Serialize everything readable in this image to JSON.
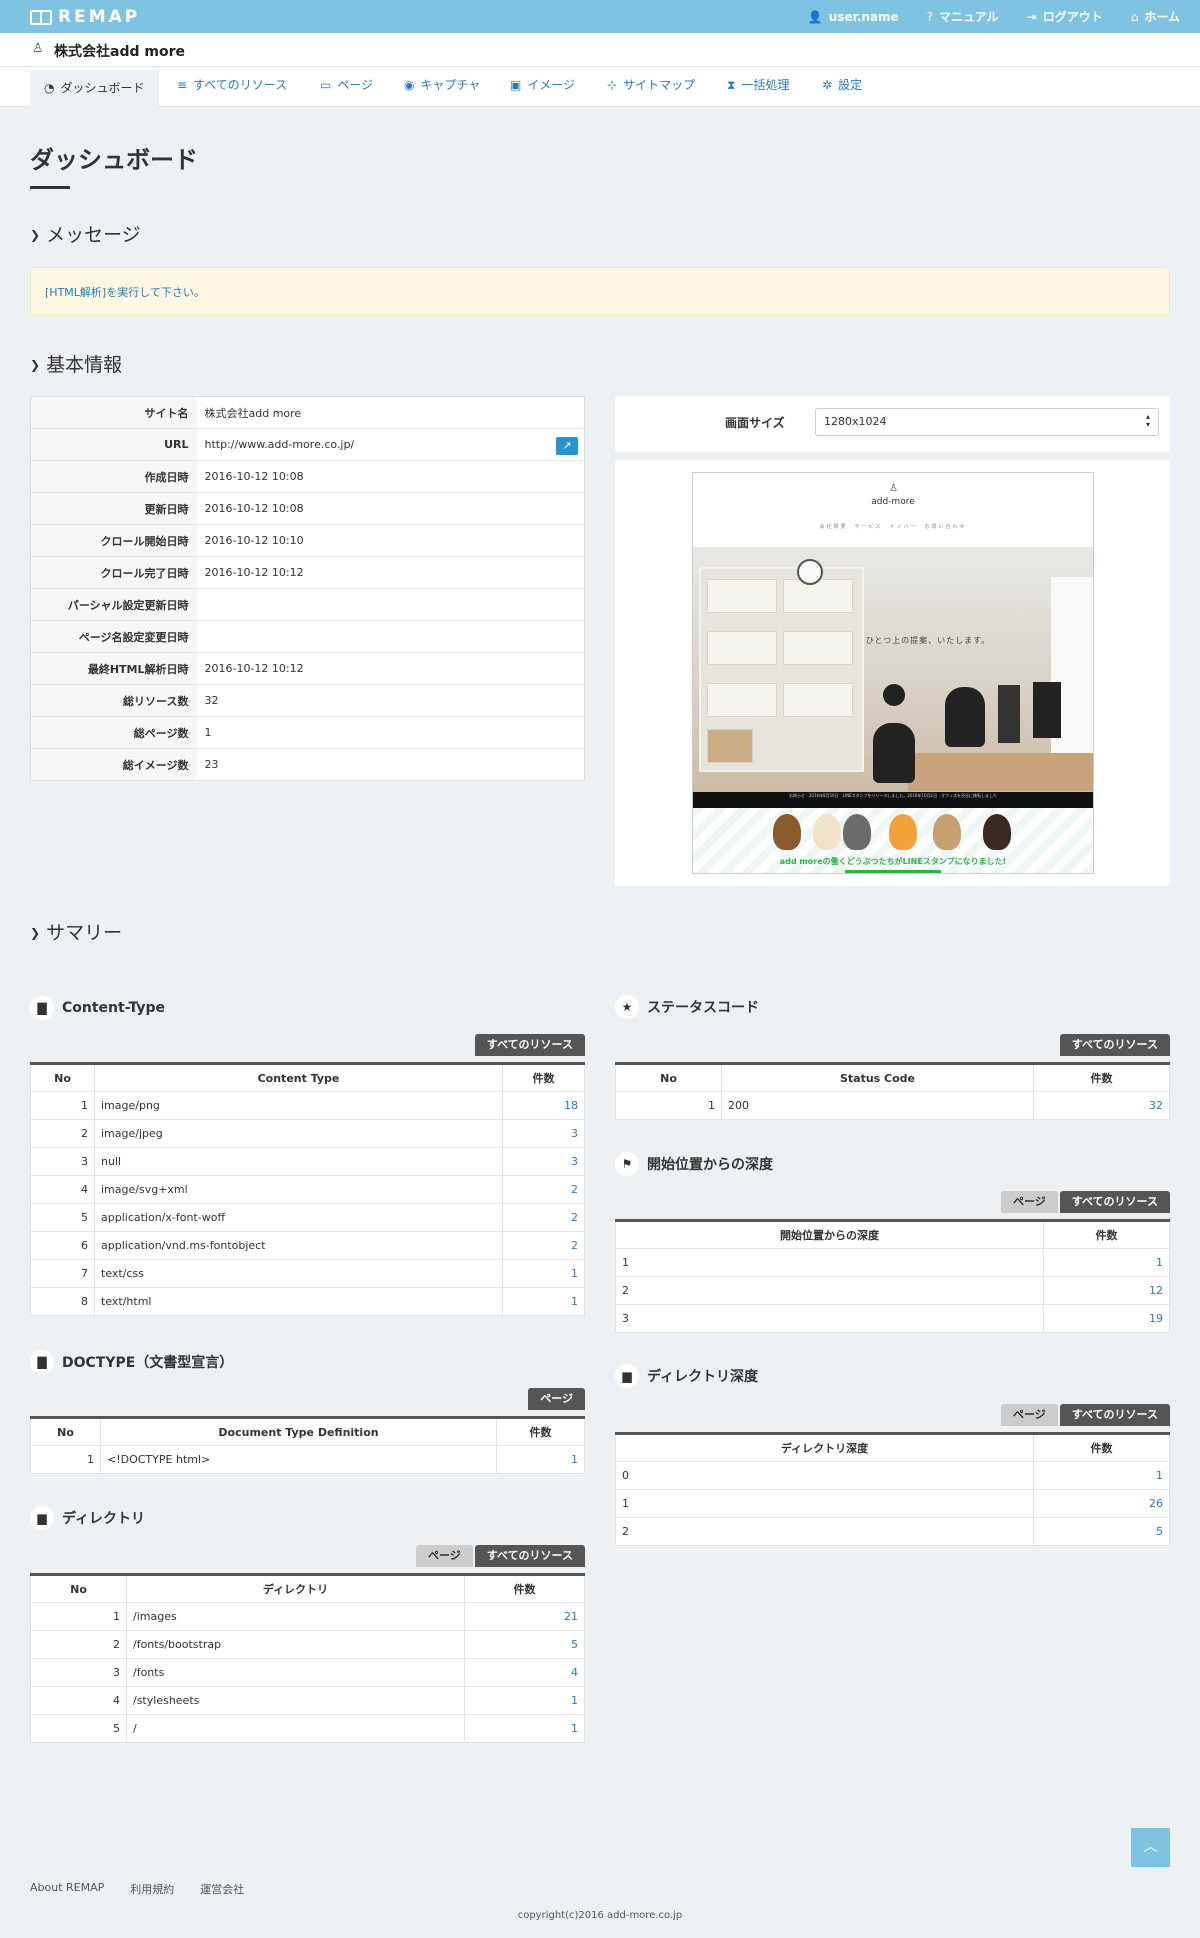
{
  "app": {
    "logo": "REMAP"
  },
  "topnav": [
    {
      "icon": "user-icon",
      "glyph": "👤",
      "label": "user.name"
    },
    {
      "icon": "help-icon",
      "glyph": "?",
      "label": "マニュアル"
    },
    {
      "icon": "logout-icon",
      "glyph": "⇥",
      "label": "ログアウト"
    },
    {
      "icon": "home-icon",
      "glyph": "⌂",
      "label": "ホーム"
    }
  ],
  "site": {
    "name": "株式会社add more"
  },
  "tabs": [
    {
      "label": "ダッシュボード",
      "glyph": "◔"
    },
    {
      "label": "すべてのリソース",
      "glyph": "≡"
    },
    {
      "label": "ページ",
      "glyph": "▭"
    },
    {
      "label": "キャプチャ",
      "glyph": "◉"
    },
    {
      "label": "イメージ",
      "glyph": "▣"
    },
    {
      "label": "サイトマップ",
      "glyph": "⊹"
    },
    {
      "label": "一括処理",
      "glyph": "⧗"
    },
    {
      "label": "設定",
      "glyph": "✲"
    }
  ],
  "page": {
    "title": "ダッシュボード"
  },
  "sections": {
    "message": "メッセージ",
    "basic": "基本情報",
    "summary": "サマリー"
  },
  "message": {
    "text": "[HTML解析]を実行して下さい。"
  },
  "info": {
    "rows": [
      {
        "k": "サイト名",
        "v": "株式会社add more"
      },
      {
        "k": "URL",
        "v": "http://www.add-more.co.jp/"
      },
      {
        "k": "作成日時",
        "v": "2016-10-12 10:08"
      },
      {
        "k": "更新日時",
        "v": "2016-10-12 10:08"
      },
      {
        "k": "クロール開始日時",
        "v": "2016-10-12 10:10"
      },
      {
        "k": "クロール完了日時",
        "v": "2016-10-12 10:12"
      },
      {
        "k": "パーシャル設定更新日時",
        "v": ""
      },
      {
        "k": "ページ名設定変更日時",
        "v": ""
      },
      {
        "k": "最終HTML解析日時",
        "v": "2016-10-12 10:12"
      },
      {
        "k": "総リソース数",
        "v": "32"
      },
      {
        "k": "総ページ数",
        "v": "1"
      },
      {
        "k": "総イメージ数",
        "v": "23"
      }
    ]
  },
  "screen": {
    "label": "画面サイズ",
    "value": "1280x1024"
  },
  "preview": {
    "brand": "add-more",
    "nav": "会社概要　サービス　メンバー　お問い合わせ",
    "hero_copy": "ひとつ上の提案、いたします。",
    "ticker": "お知らせ　2016年8月16日　LINEスタンプをリリースしました。2016年10月1日　オフィスを渋谷に移転しました",
    "banner": "add moreの働くどうぶつたちがLINEスタンプになりました!"
  },
  "buttons": {
    "all_resources": "すべてのリソース",
    "page": "ページ"
  },
  "content_type": {
    "title": "Content-Type",
    "headers": [
      "No",
      "Content Type",
      "件数"
    ],
    "rows": [
      [
        "1",
        "image/png",
        "18"
      ],
      [
        "2",
        "image/jpeg",
        "3"
      ],
      [
        "3",
        "null",
        "3"
      ],
      [
        "4",
        "image/svg+xml",
        "2"
      ],
      [
        "5",
        "application/x-font-woff",
        "2"
      ],
      [
        "6",
        "application/vnd.ms-fontobject",
        "2"
      ],
      [
        "7",
        "text/css",
        "1"
      ],
      [
        "8",
        "text/html",
        "1"
      ]
    ]
  },
  "doctype": {
    "title": "DOCTYPE（文書型宣言）",
    "headers": [
      "No",
      "Document Type Definition",
      "件数"
    ],
    "rows": [
      [
        "1",
        "<!DOCTYPE html>",
        "1"
      ]
    ]
  },
  "directory": {
    "title": "ディレクトリ",
    "headers": [
      "No",
      "ディレクトリ",
      "件数"
    ],
    "rows": [
      [
        "1",
        "/images",
        "21"
      ],
      [
        "2",
        "/fonts/bootstrap",
        "5"
      ],
      [
        "3",
        "/fonts",
        "4"
      ],
      [
        "4",
        "/stylesheets",
        "1"
      ],
      [
        "5",
        "/",
        "1"
      ]
    ]
  },
  "status": {
    "title": "ステータスコード",
    "headers": [
      "No",
      "Status Code",
      "件数"
    ],
    "rows": [
      [
        "1",
        "200",
        "32"
      ]
    ]
  },
  "depth": {
    "title": "開始位置からの深度",
    "headers": [
      "開始位置からの深度",
      "件数"
    ],
    "rows": [
      [
        "1",
        "1"
      ],
      [
        "2",
        "12"
      ],
      [
        "3",
        "19"
      ]
    ]
  },
  "dirdepth": {
    "title": "ディレクトリ深度",
    "headers": [
      "ディレクトリ深度",
      "件数"
    ],
    "rows": [
      [
        "0",
        "1"
      ],
      [
        "1",
        "26"
      ],
      [
        "2",
        "5"
      ]
    ]
  },
  "footer": {
    "links": [
      "About REMAP",
      "利用規約",
      "運営会社"
    ],
    "copyright": "copyright(c)2016 add-more.co.jp",
    "totop": "︿"
  }
}
